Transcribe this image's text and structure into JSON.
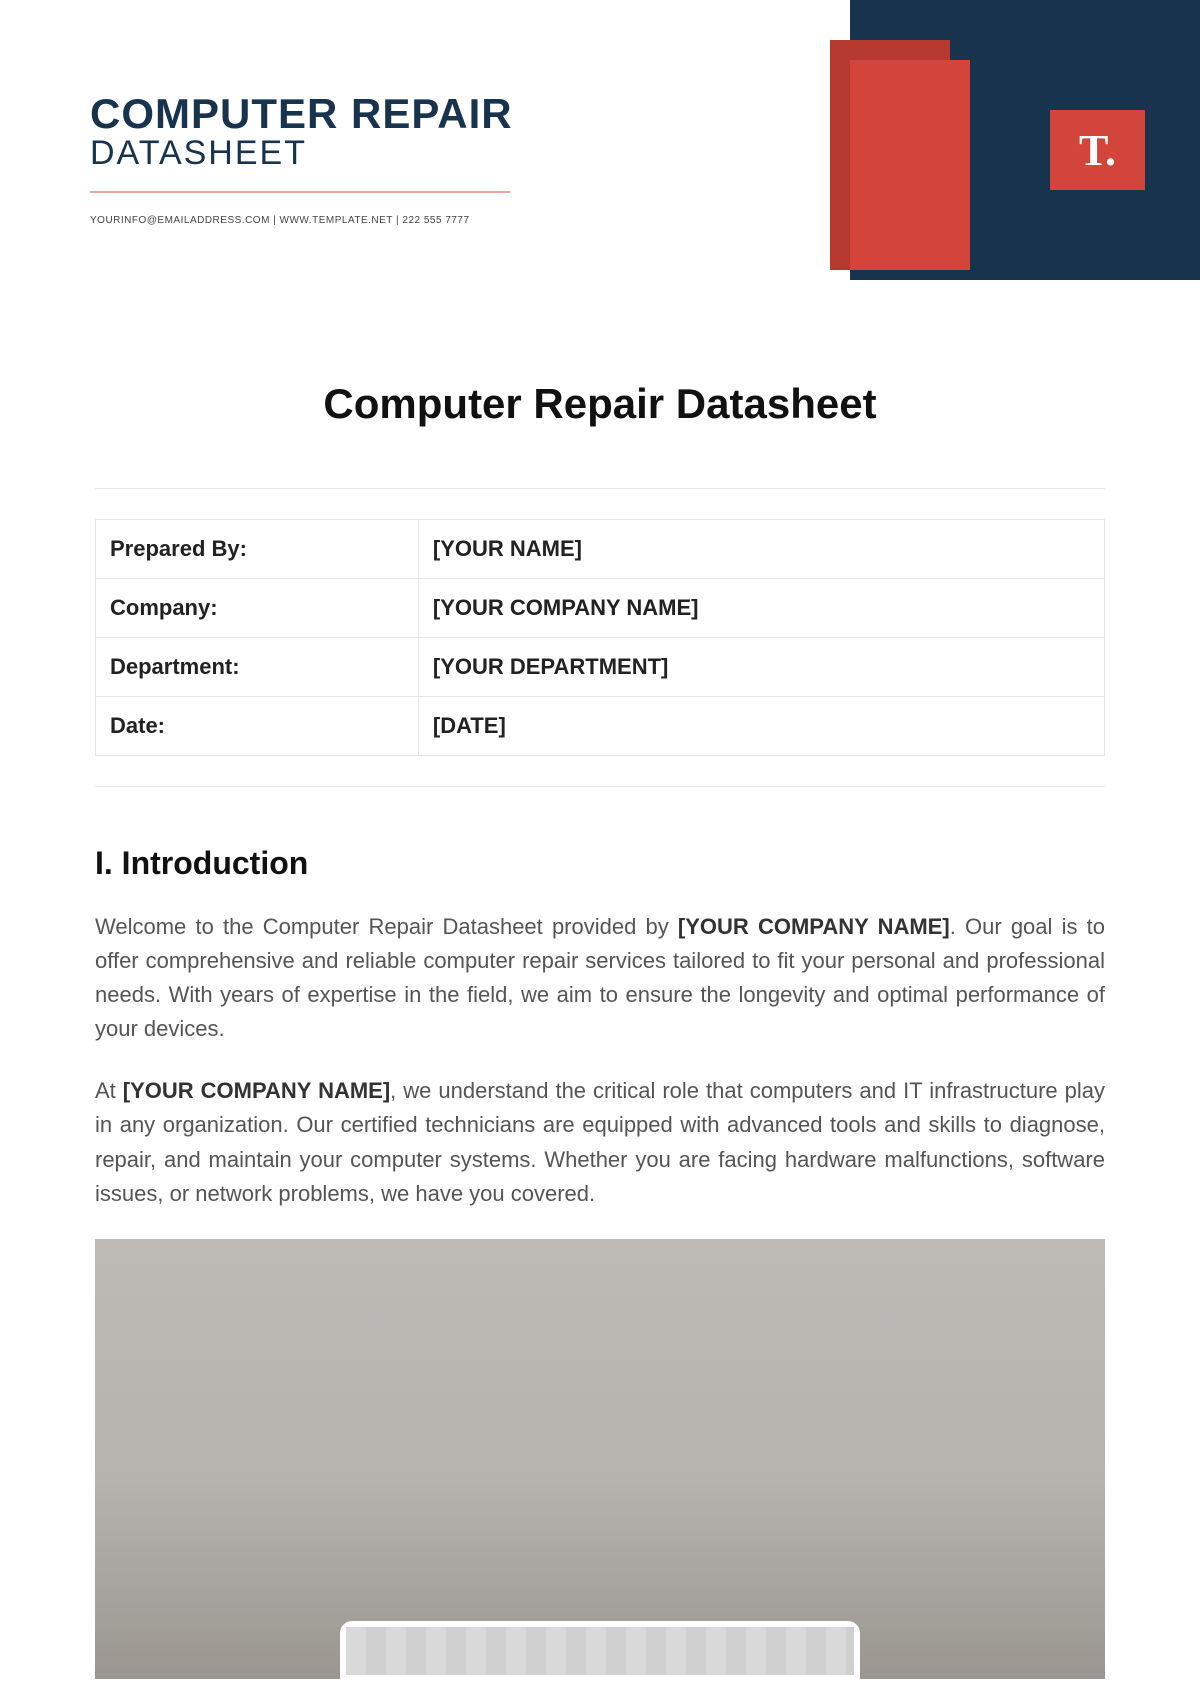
{
  "header": {
    "title_line1": "COMPUTER REPAIR",
    "title_line2": "DATASHEET",
    "contact": "YOURINFO@EMAILADDRESS.COM | WWW.TEMPLATE.NET | 222 555 7777",
    "logo_text": "T."
  },
  "document": {
    "title": "Computer Repair Datasheet",
    "info_rows": [
      {
        "label": "Prepared By:",
        "value": "[YOUR NAME]"
      },
      {
        "label": "Company:",
        "value": "[YOUR COMPANY NAME]"
      },
      {
        "label": "Department:",
        "value": "[YOUR DEPARTMENT]"
      },
      {
        "label": "Date:",
        "value": "[DATE]"
      }
    ],
    "section1_heading": "I. Introduction",
    "p1_a": "Welcome to the Computer Repair Datasheet provided by ",
    "p1_bold": "[YOUR COMPANY NAME]",
    "p1_b": ". Our goal is to offer comprehensive and reliable computer repair services tailored to fit your personal and professional needs. With years of expertise in the field, we aim to ensure the longevity and optimal performance of your devices.",
    "p2_a": "At ",
    "p2_bold": "[YOUR COMPANY NAME]",
    "p2_b": ", we understand the critical role that computers and IT infrastructure play in any organization. Our certified technicians are equipped with advanced tools and skills to diagnose, repair, and maintain your computer systems. Whether you are facing hardware malfunctions, software issues, or network problems, we have you covered."
  }
}
